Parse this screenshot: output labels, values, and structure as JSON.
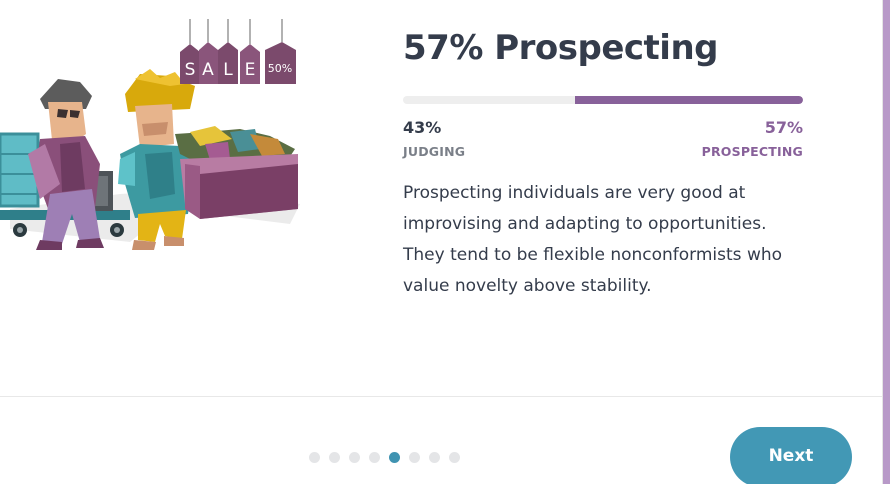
{
  "result": {
    "title": "57% Prospecting",
    "prospecting_fraction": 0.57,
    "left": {
      "percent": "43%",
      "trait": "JUDGING"
    },
    "right": {
      "percent": "57%",
      "trait": "PROSPECTING"
    },
    "description": "Prospecting individuals are very good at improvising and adapting to opportunities. They tend to be flexible nonconformists who value novelty above stability."
  },
  "illustration": {
    "tags": [
      "S",
      "A",
      "L",
      "E",
      "50%"
    ]
  },
  "pagination": {
    "total": 8,
    "active_index": 4
  },
  "footer": {
    "next_label": "Next"
  },
  "colors": {
    "accent": "#88619a",
    "button": "#4298b5",
    "active_dot": "#3f93b1",
    "text": "#343c4b"
  }
}
